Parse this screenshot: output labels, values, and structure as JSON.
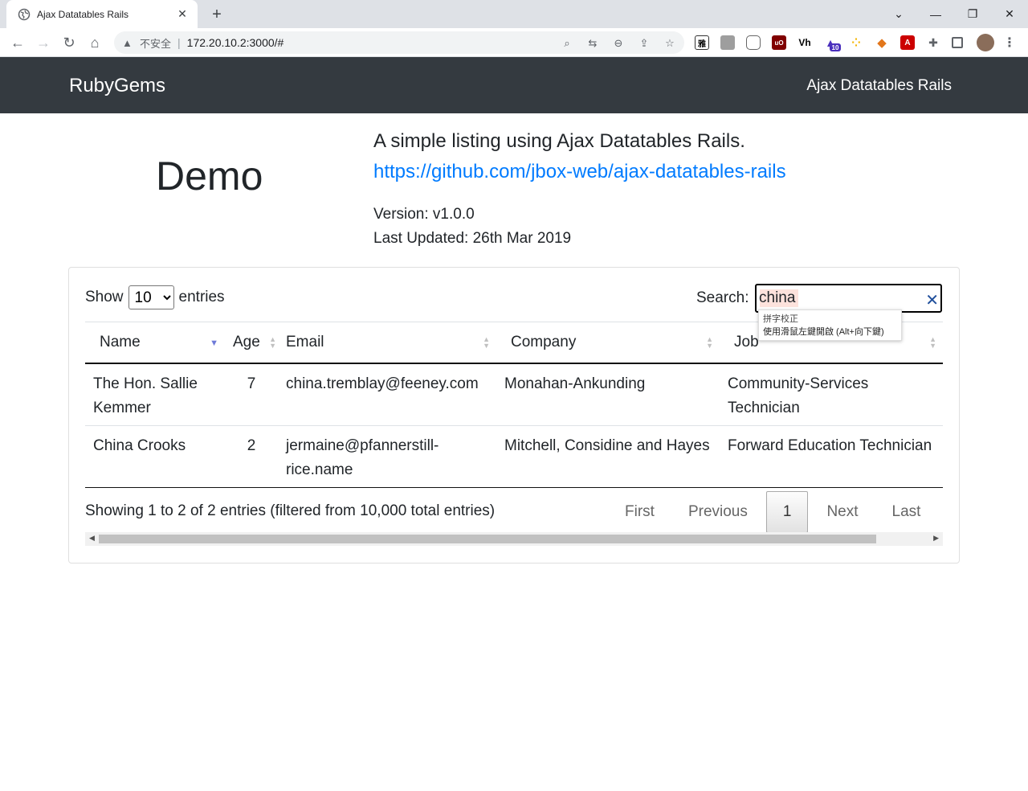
{
  "browser": {
    "tab_title": "Ajax Datatables Rails",
    "security_label": "不安全",
    "url": "172.20.10.2:3000/#",
    "ext_badge": "10",
    "ext_ya": "雅"
  },
  "navbar": {
    "brand": "RubyGems",
    "link": "Ajax Datatables Rails"
  },
  "hero": {
    "title": "Demo",
    "lead": "A simple listing using Ajax Datatables Rails.",
    "link": "https://github.com/jbox-web/ajax-datatables-rails",
    "version": "Version: v1.0.0",
    "updated": "Last Updated: 26th Mar 2019"
  },
  "table_controls": {
    "show": "Show",
    "entries": "entries",
    "length_value": "10",
    "search_label": "Search:",
    "search_value": "china",
    "tooltip_title": "拼字校正",
    "tooltip_body": "使用滑鼠左鍵開啟 (Alt+向下鍵)"
  },
  "columns": [
    "Name",
    "Age",
    "Email",
    "Company",
    "Job"
  ],
  "rows": [
    {
      "name": "The Hon. Sallie Kemmer",
      "age": "7",
      "email": "china.tremblay@feeney.com",
      "company": "Monahan-Ankunding",
      "job": "Community-Services Technician"
    },
    {
      "name": "China Crooks",
      "age": "2",
      "email": "jermaine@pfannerstill-rice.name",
      "company": "Mitchell, Considine and Hayes",
      "job": "Forward Education Technician"
    }
  ],
  "footer": {
    "info": "Showing 1 to 2 of 2 entries (filtered from 10,000 total entries)",
    "first": "First",
    "previous": "Previous",
    "page": "1",
    "next": "Next",
    "last": "Last"
  }
}
